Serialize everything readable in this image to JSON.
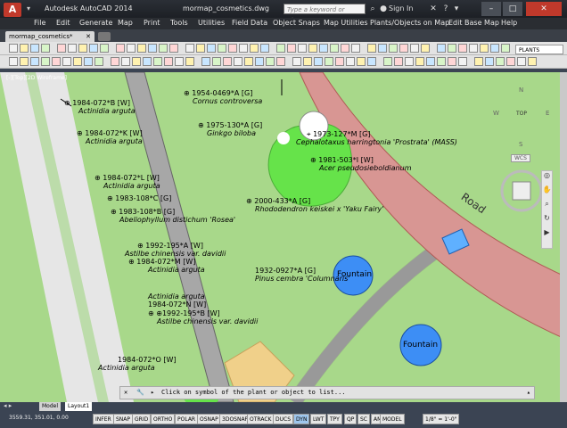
{
  "title_bar": {
    "app_title": "Autodesk AutoCAD 2014",
    "doc_title": "mormap_cosmetics.dwg",
    "search_placeholder": "Type a keyword or phrase",
    "sign_in": "Sign In",
    "minimize": "–",
    "maximize": "□",
    "close": "✕"
  },
  "menu": [
    "File",
    "Edit",
    "Generate",
    "Map",
    "Print",
    "Tools",
    "Utilities",
    "Field Data",
    "Object Snaps",
    "Map Utilities",
    "Plants/Objects on Map",
    "Edit Base Map",
    "Help"
  ],
  "file_tab": {
    "label": "mormap_cosmetics*",
    "close": "✕"
  },
  "layer_dropdown": {
    "value": "PLANTS"
  },
  "viewport": {
    "label": "[-][Top][2D Wireframe]",
    "road_label": "Road",
    "fountains": [
      "Fountain",
      "Fountain"
    ],
    "plants": [
      {
        "acc": "1954-0469*A [G]",
        "name": "Cornus controversa"
      },
      {
        "acc": "1984-072*B [W]",
        "name": "Actinidia arguta"
      },
      {
        "acc": "1975-130*A [G]",
        "name": "Ginkgo biloba"
      },
      {
        "acc": "1973-127*M [G]",
        "name": "Cephalotaxus harringtonia 'Prostrata' (MASS)"
      },
      {
        "acc": "1984-072*K [W]",
        "name": "Actinidia arguta"
      },
      {
        "acc": "1981-503*I [W]",
        "name": "Acer pseudosieboldianum"
      },
      {
        "acc": "1984-072*L [W]",
        "name": "Actinidia arguta"
      },
      {
        "acc": "1983-108*C [G]",
        "name": ""
      },
      {
        "acc": "1983-108*B [G]",
        "name": "Abeliophyllum distichum 'Rosea'"
      },
      {
        "acc": "2000-433*A [G]",
        "name": "Rhododendron keiskei x 'Yaku Fairy'"
      },
      {
        "acc": "1992-195*A [W]",
        "name": "Astilbe chinensis var. davidii"
      },
      {
        "acc": "1984-072*M [W]",
        "name": "Actinidia arguta"
      },
      {
        "acc": "1932-0927*A [G]",
        "name": "Pinus cembra 'Columnaris'"
      },
      {
        "acc": "",
        "name": "Actinidia arguta"
      },
      {
        "acc": "1984-072*N [W]",
        "name": ""
      },
      {
        "acc": "1992-195*B [W]",
        "name": "Astilbe chinensis var. davidii"
      },
      {
        "acc": "1984-072*O [W]",
        "name": "Actinidia arguta"
      }
    ]
  },
  "viewcube": {
    "n": "N",
    "s": "S",
    "e": "E",
    "w": "W",
    "top": "TOP",
    "wcs": "WCS"
  },
  "command_line": {
    "prompt": "Click on symbol of the plant or object to list..."
  },
  "layout_tabs": [
    "Model",
    "Layout1"
  ],
  "status_bar": {
    "coords": "3559.31, 351.01, 0.00",
    "toggles": [
      "INFER",
      "SNAP",
      "GRID",
      "ORTHO",
      "POLAR",
      "OSNAP",
      "3DOSNAP",
      "OTRACK",
      "DUCS",
      "DYN",
      "LWT",
      "TPY",
      "QP",
      "SC",
      "AM"
    ],
    "model": "MODEL",
    "scale": "1/8\" = 1'-0\""
  }
}
